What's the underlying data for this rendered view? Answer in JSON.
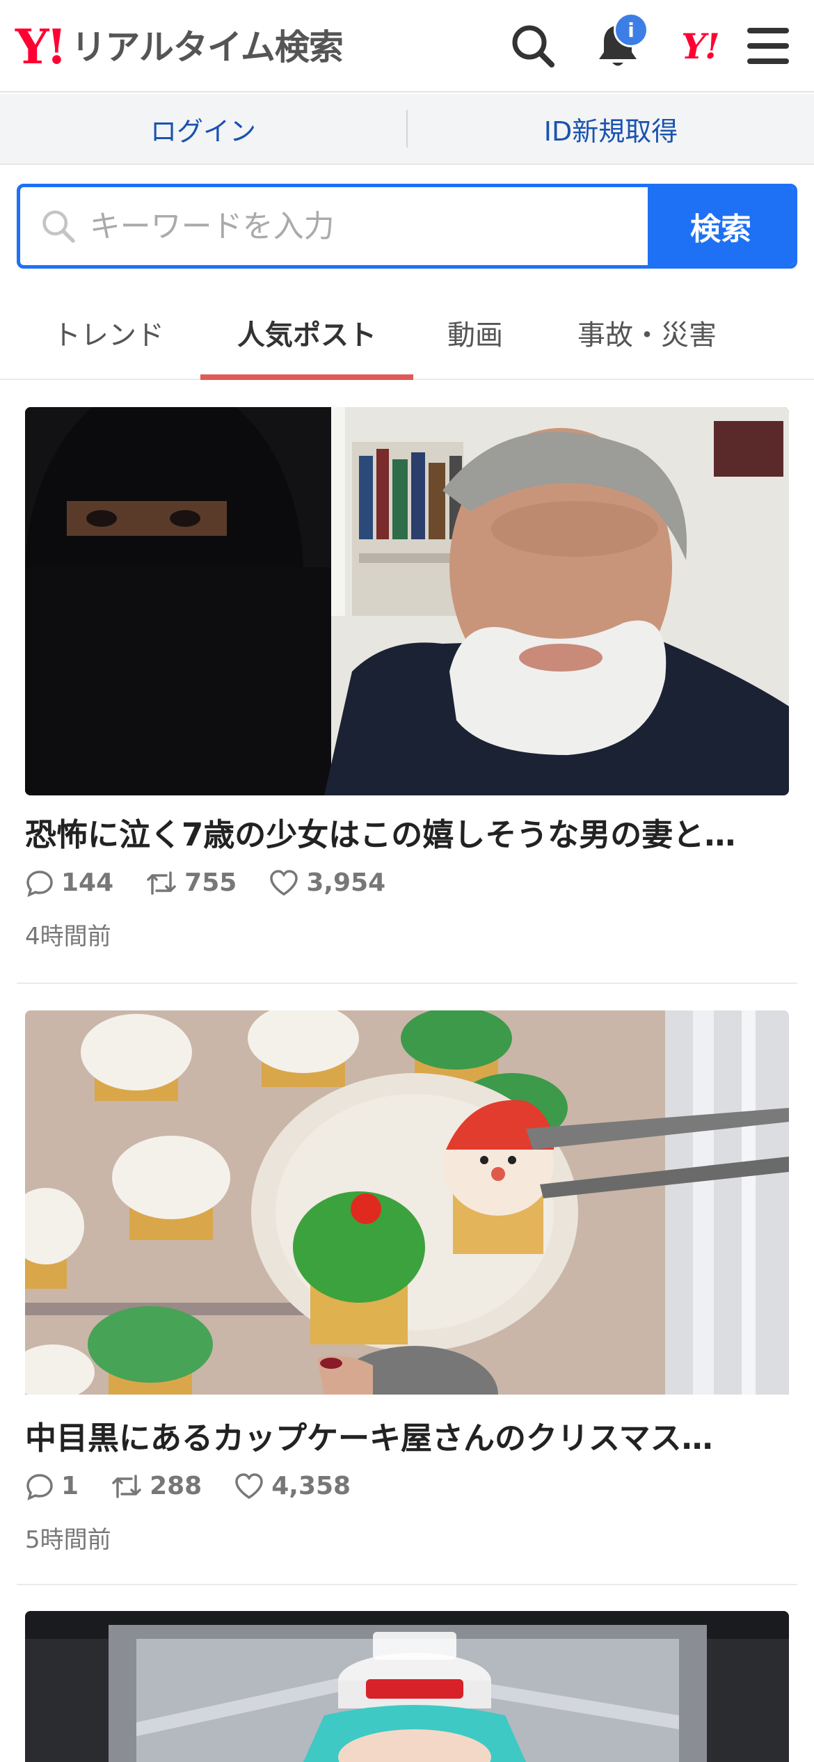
{
  "header": {
    "logo_mark": "Y!",
    "logo_text": "リアルタイム検索",
    "notification_badge": "i",
    "yahoo_mark": "Y!"
  },
  "login_bar": {
    "login_label": "ログイン",
    "signup_label": "ID新規取得"
  },
  "search": {
    "placeholder": "キーワードを入力",
    "button_label": "検索"
  },
  "tabs": [
    {
      "label": "トレンド",
      "active": false
    },
    {
      "label": "人気ポスト",
      "active": true
    },
    {
      "label": "動画",
      "active": false
    },
    {
      "label": "事故・災害",
      "active": false
    }
  ],
  "posts": [
    {
      "title": "恐怖に泣く7歳の少女はこの嬉しそうな男の妻と…",
      "replies": "144",
      "reposts": "755",
      "likes": "3,954",
      "time": "4時間前"
    },
    {
      "title": "中目黒にあるカップケーキ屋さんのクリスマス…",
      "replies": "1",
      "reposts": "288",
      "likes": "4,358",
      "time": "5時間前"
    }
  ],
  "colors": {
    "brand_red": "#ff0033",
    "accent_blue": "#1e71f4",
    "tab_active_underline": "#e05a55",
    "link_blue": "#1a53b0"
  }
}
